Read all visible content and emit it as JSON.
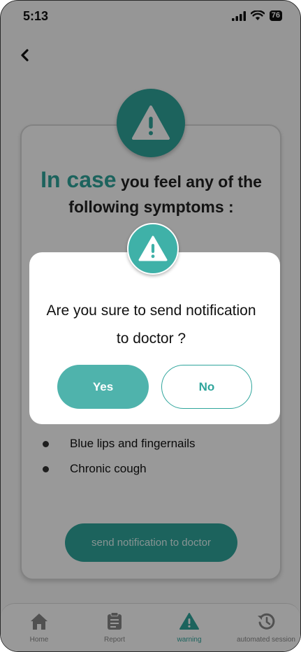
{
  "status_bar": {
    "time": "5:13",
    "battery": "76",
    "icons": [
      "signal-icon",
      "wifi-icon",
      "battery-icon"
    ]
  },
  "header": {
    "back_icon": "chevron-left-icon"
  },
  "card": {
    "heading_highlight": "In case",
    "heading_rest_line1": "you feel any of the",
    "heading_line2": "following symptoms :",
    "symptoms": [
      "Blue lips and fingernails",
      "Chronic cough"
    ],
    "send_label": "send notification to doctor"
  },
  "dialog": {
    "message_line1": "Are you sure to send notification",
    "message_line2": "to doctor ?",
    "yes_label": "Yes",
    "no_label": "No"
  },
  "tabbar": {
    "items": [
      {
        "label": "Home",
        "icon": "home-icon"
      },
      {
        "label": "Report",
        "icon": "report-icon"
      },
      {
        "label": "warning",
        "icon": "warning-icon"
      },
      {
        "label": "automated session",
        "icon": "history-icon"
      }
    ],
    "active": "warning"
  },
  "colors": {
    "accent": "#2fa59c",
    "accent_light": "#4fb3ac",
    "overlay": "rgba(0,0,0,0.40)"
  }
}
